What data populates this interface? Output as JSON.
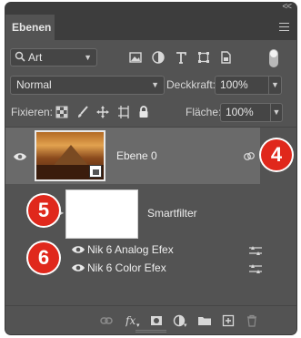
{
  "window": {
    "collapse_glyph": "<<"
  },
  "tabs": [
    {
      "label": "Ebenen"
    }
  ],
  "filter": {
    "kind_value": "Art"
  },
  "blend": {
    "mode_value": "Normal",
    "opacity_label": "Deckkraft:",
    "opacity_value": "100%"
  },
  "lock": {
    "label": "Fixieren:",
    "fill_label": "Fläche:",
    "fill_value": "100%"
  },
  "layers": [
    {
      "name": "Ebene 0"
    }
  ],
  "smartfilter": {
    "label": "Smartfilter",
    "filters": [
      {
        "name": "Nik 6 Analog Efex"
      },
      {
        "name": "Nik 6 Color Efex"
      }
    ]
  },
  "callouts": [
    "4",
    "5",
    "6"
  ],
  "colors": {
    "panel": "#535353",
    "selected_row": "#6a6a6a",
    "callout": "#e0281c"
  }
}
